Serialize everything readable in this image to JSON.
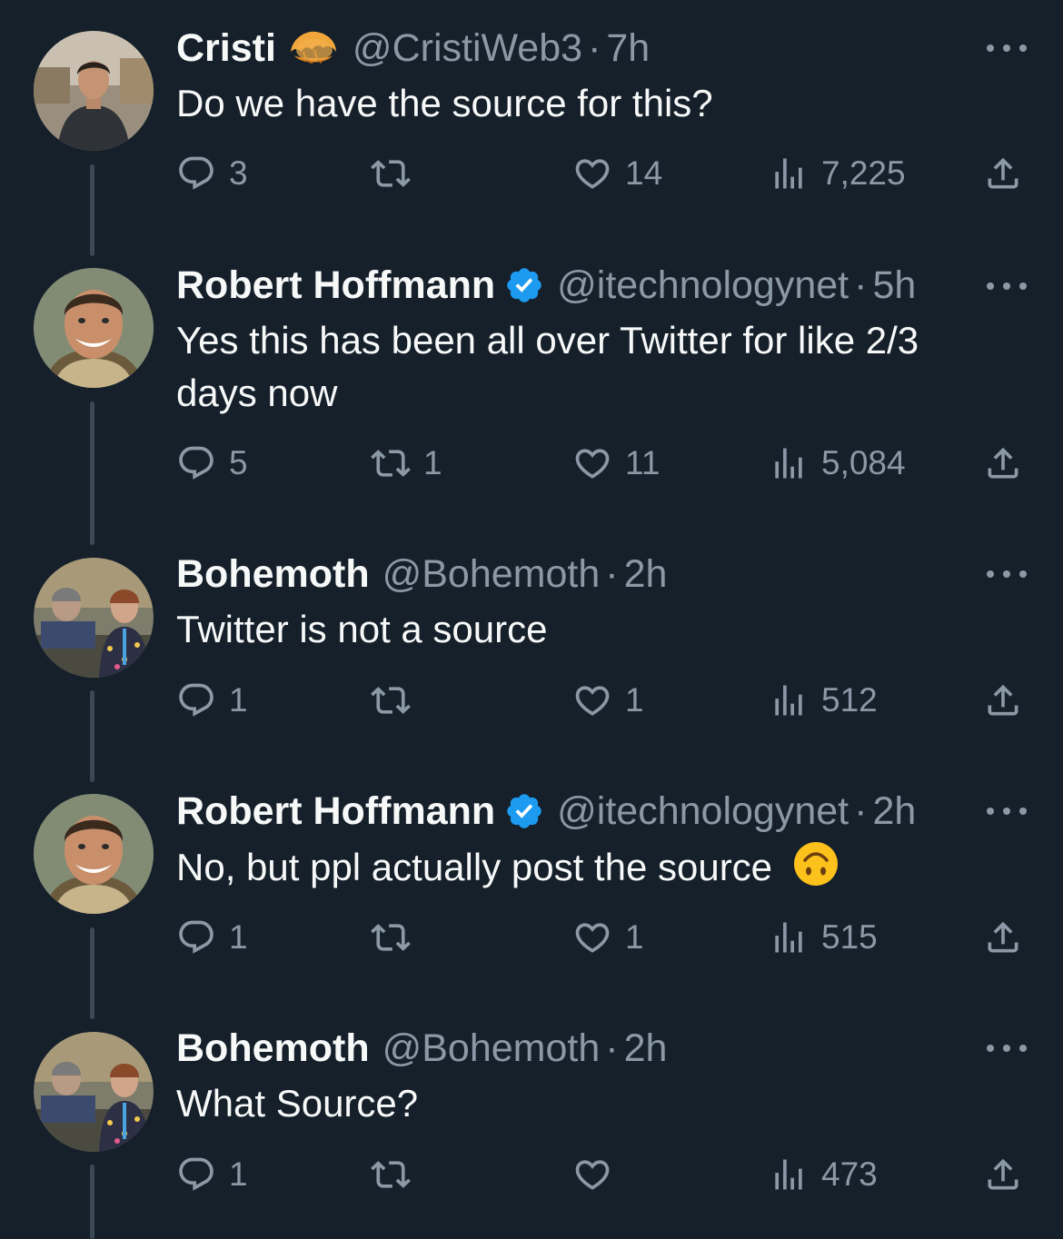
{
  "colors": {
    "background": "#15202b",
    "text_primary": "#f7f9f9",
    "text_secondary": "#8b98a5",
    "verified_blue": "#1d9bf0",
    "thread_line": "#3b4957"
  },
  "tweets": [
    {
      "name": "Cristi",
      "name_emoji": "croissant-emoji",
      "verified": false,
      "handle": "@CristiWeb3",
      "separator": "·",
      "time": "7h",
      "text": "Do we have the source for this?",
      "replies": "3",
      "retweets": "",
      "likes": "14",
      "views": "7,225"
    },
    {
      "name": "Robert Hoffmann",
      "verified": true,
      "handle": "@itechnologynet",
      "separator": "·",
      "time": "5h",
      "text": "Yes this has been all over Twitter for like 2/3 days now",
      "replies": "5",
      "retweets": "1",
      "likes": "11",
      "views": "5,084"
    },
    {
      "name": "Bohemoth",
      "verified": false,
      "handle": "@Bohemoth",
      "separator": "·",
      "time": "2h",
      "text": "Twitter is not a source",
      "replies": "1",
      "retweets": "",
      "likes": "1",
      "views": "512"
    },
    {
      "name": "Robert Hoffmann",
      "verified": true,
      "handle": "@itechnologynet",
      "separator": "·",
      "time": "2h",
      "text": "No, but ppl actually post the source",
      "text_emoji": "upside-down-face-emoji",
      "replies": "1",
      "retweets": "",
      "likes": "1",
      "views": "515"
    },
    {
      "name": "Bohemoth",
      "verified": false,
      "handle": "@Bohemoth",
      "separator": "·",
      "time": "2h",
      "text": "What Source?",
      "replies": "1",
      "retweets": "",
      "likes": "",
      "views": "473"
    }
  ]
}
